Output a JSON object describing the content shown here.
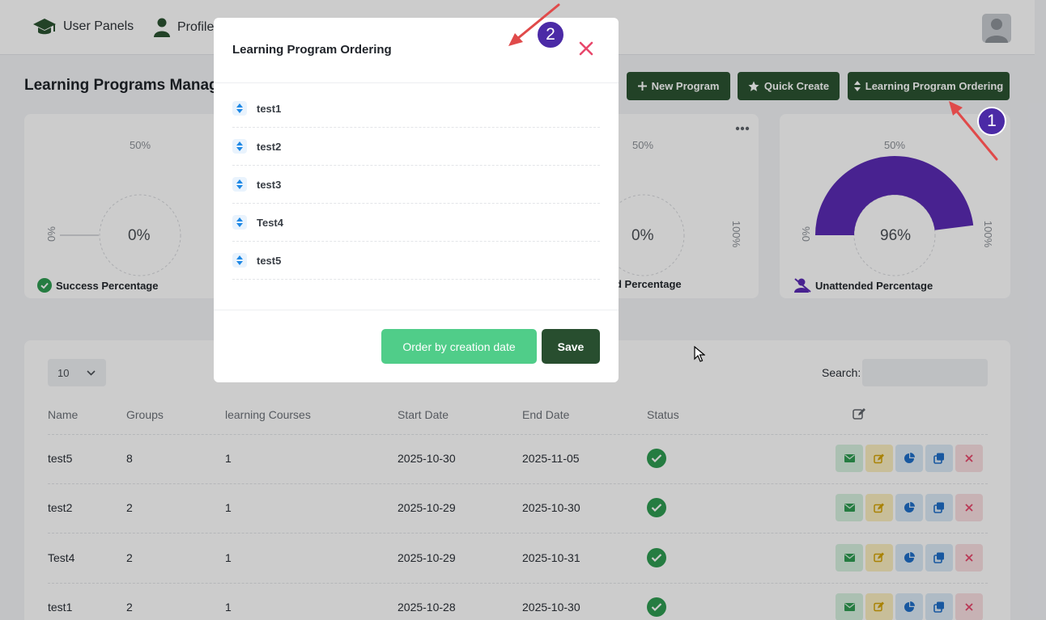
{
  "nav": {
    "user_panels": "User Panels",
    "profile": "Profile"
  },
  "page": {
    "title": "Learning Programs Managen"
  },
  "toolbar": {
    "new_program": "New Program",
    "quick_create": "Quick Create",
    "ordering": "Learning Program Ordering"
  },
  "cards": [
    {
      "label": "Success Percentage",
      "value": "0%",
      "tick_top": "50%",
      "tick_left": "0%",
      "tick_right": ""
    },
    {
      "label": "d Percentage",
      "value": "0%",
      "tick_top": "50%",
      "tick_left": "",
      "tick_right": "100%"
    },
    {
      "label": "Unattended Percentage",
      "value": "96%",
      "tick_top": "50%",
      "tick_left": "0%",
      "tick_right": "100%",
      "fill": 0.96
    }
  ],
  "table": {
    "page_length": "10",
    "search_label": "Search:",
    "headers": [
      "Name",
      "Groups",
      "learning Courses",
      "Start Date",
      "End Date",
      "Status"
    ],
    "rows": [
      [
        "test5",
        "8",
        "1",
        "2025-10-30",
        "2025-11-05"
      ],
      [
        "test2",
        "2",
        "1",
        "2025-10-29",
        "2025-10-30"
      ],
      [
        "Test4",
        "2",
        "1",
        "2025-10-29",
        "2025-10-31"
      ],
      [
        "test1",
        "2",
        "1",
        "2025-10-28",
        "2025-10-30"
      ]
    ]
  },
  "modal": {
    "title": "Learning Program Ordering",
    "items": [
      "test1",
      "test2",
      "test3",
      "Test4",
      "test5"
    ],
    "order_by_date": "Order by creation date",
    "save": "Save"
  },
  "annotations": {
    "badge_1": "1",
    "badge_2": "2"
  },
  "colors": {
    "brand_dark": "#2b5331",
    "success": "#50cd89",
    "purple": "#5b2bb5",
    "danger": "#e8476b"
  }
}
